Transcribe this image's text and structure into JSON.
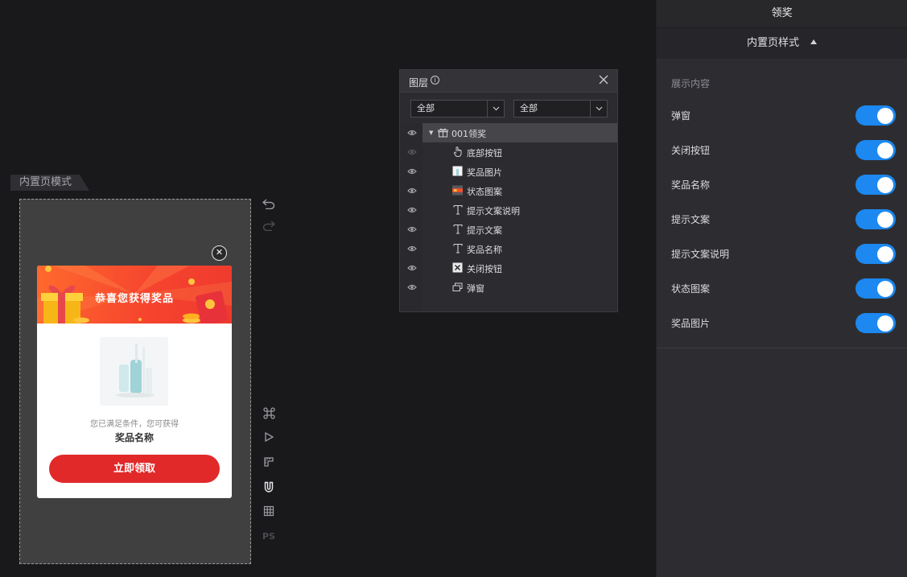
{
  "canvas": {
    "mode_tag": "内置页模式",
    "popup": {
      "title": "恭喜您获得奖品",
      "description": "您已满足条件，您可获得",
      "prize_name": "奖品名称",
      "cta_label": "立即领取",
      "close_glyph": "✕"
    }
  },
  "tools": {
    "items": [
      "undo-icon",
      "redo-icon",
      "command-icon",
      "play-icon",
      "ruler-icon",
      "magnet-icon",
      "grid-icon"
    ],
    "ps_label": "PS"
  },
  "layers_panel": {
    "title": "图层",
    "filter1": "全部",
    "filter2": "全部",
    "group": {
      "name": "001领奖",
      "icon": "gift-icon"
    },
    "items": [
      {
        "name": "底部按钮",
        "icon": "hand-pointer-icon",
        "visible": false
      },
      {
        "name": "奖品图片",
        "icon": "image-thumb-icon",
        "visible": true
      },
      {
        "name": "状态图案",
        "icon": "banner-thumb-icon",
        "visible": true
      },
      {
        "name": "提示文案说明",
        "icon": "text-icon",
        "visible": true
      },
      {
        "name": "提示文案",
        "icon": "text-icon",
        "visible": true
      },
      {
        "name": "奖品名称",
        "icon": "text-icon",
        "visible": true
      },
      {
        "name": "关闭按钮",
        "icon": "close-thumb-icon",
        "visible": true
      },
      {
        "name": "弹窗",
        "icon": "window-icon",
        "visible": true
      }
    ]
  },
  "settings_panel": {
    "title": "领奖",
    "section_title": "内置页样式",
    "content_label": "展示内容",
    "toggles": [
      {
        "label": "弹窗",
        "on": true
      },
      {
        "label": "关闭按钮",
        "on": true
      },
      {
        "label": "奖品名称",
        "on": true
      },
      {
        "label": "提示文案",
        "on": true
      },
      {
        "label": "提示文案说明",
        "on": true
      },
      {
        "label": "状态图案",
        "on": true
      },
      {
        "label": "奖品图片",
        "on": true
      }
    ],
    "accent_color": "#1c88f0"
  }
}
